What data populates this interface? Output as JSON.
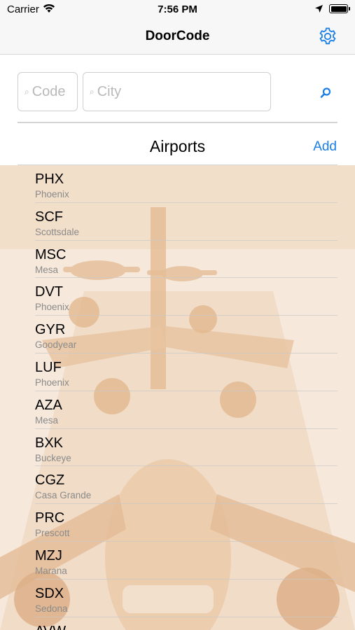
{
  "status_bar": {
    "carrier": "Carrier",
    "time": "7:56 PM"
  },
  "nav": {
    "title": "DoorCode",
    "settings_icon": "gear-icon"
  },
  "search": {
    "code_placeholder": "Code",
    "city_placeholder": "City",
    "search_icon": "search-icon"
  },
  "section": {
    "title": "Airports",
    "add_label": "Add"
  },
  "airports": [
    {
      "code": "PHX",
      "city": "Phoenix"
    },
    {
      "code": "SCF",
      "city": "Scottsdale"
    },
    {
      "code": "MSC",
      "city": "Mesa"
    },
    {
      "code": "DVT",
      "city": "Phoenix"
    },
    {
      "code": "GYR",
      "city": "Goodyear"
    },
    {
      "code": "LUF",
      "city": "Phoenix"
    },
    {
      "code": "AZA",
      "city": "Mesa"
    },
    {
      "code": "BXK",
      "city": "Buckeye"
    },
    {
      "code": "CGZ",
      "city": "Casa Grande"
    },
    {
      "code": "PRC",
      "city": "Prescott"
    },
    {
      "code": "MZJ",
      "city": "Marana"
    },
    {
      "code": "SDX",
      "city": "Sedona"
    },
    {
      "code": "AVW",
      "city": ""
    }
  ],
  "colors": {
    "accent": "#1a7ee8",
    "background_tint": "#e9c9a8"
  }
}
